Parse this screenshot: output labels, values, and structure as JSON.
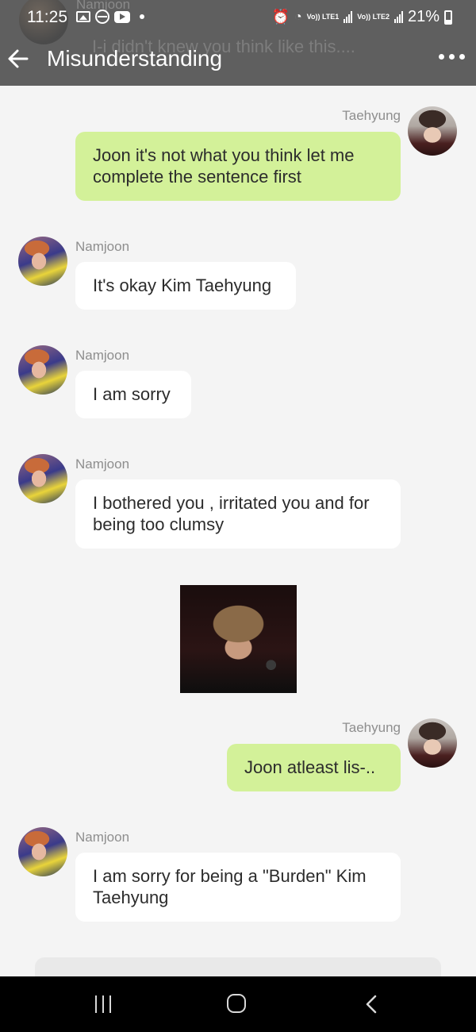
{
  "status": {
    "time": "11:25",
    "network1": "Vo)) LTE1",
    "network2": "Vo)) LTE2",
    "battery": "21%"
  },
  "header": {
    "title": "Misunderstanding",
    "ghost_sender": "Namjoon",
    "ghost_text": "I-i didn't knew you think like this...."
  },
  "messages": [
    {
      "sender": "Taehyung",
      "text": "Joon it's not what you think let me complete the sentence first"
    },
    {
      "sender": "Namjoon",
      "text": "It's okay Kim Taehyung"
    },
    {
      "sender": "Namjoon",
      "text": "I am sorry"
    },
    {
      "sender": "Namjoon",
      "text": "I bothered you , irritated you and for being too clumsy"
    },
    {
      "sender": "Taehyung",
      "text": "Joon atleast lis-.."
    },
    {
      "sender": "Namjoon",
      "text": "I am sorry for being a \"Burden\" Kim Taehyung"
    }
  ],
  "colors": {
    "topbar": "#5f5f5f",
    "background": "#f4f4f4",
    "sent_bubble": "#d3f199",
    "received_bubble": "#ffffff"
  },
  "icons": [
    "back-arrow-icon",
    "more-dots-icon",
    "alarm-icon",
    "wifi-icon",
    "signal-icon",
    "battery-icon",
    "nav-recent-icon",
    "nav-home-icon",
    "nav-back-icon"
  ]
}
